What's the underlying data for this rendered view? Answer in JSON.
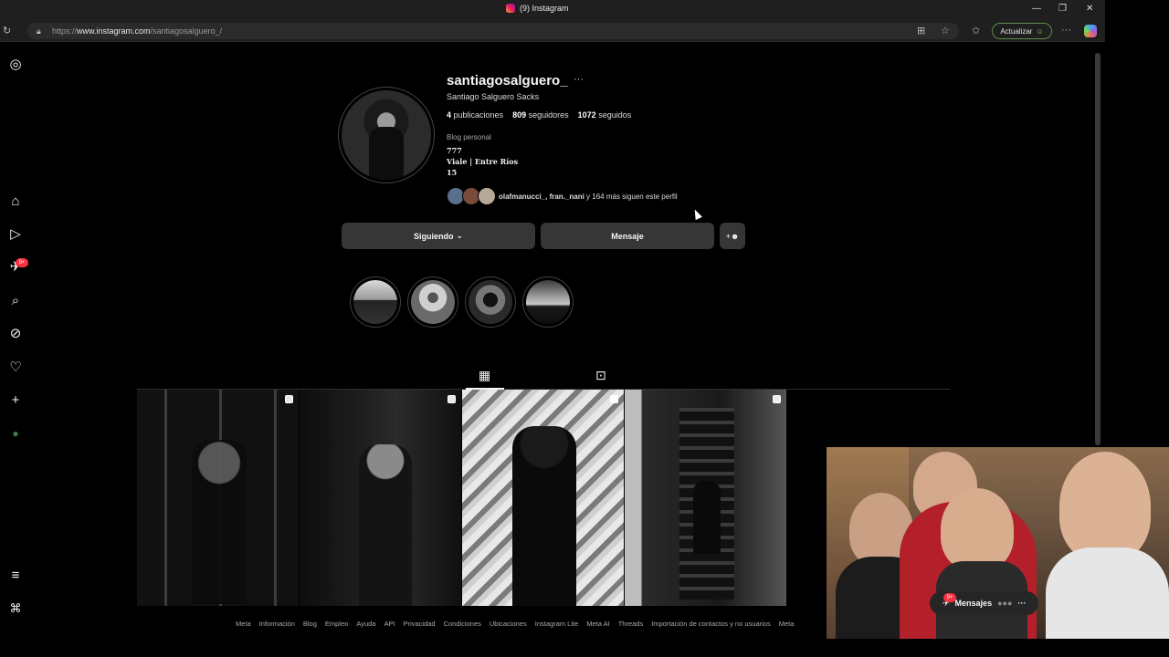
{
  "browser": {
    "tab_title": "(9) Instagram",
    "url_prefix": "https://",
    "url_domain": "www.instagram.com",
    "url_path": "/santiagosalguero_/",
    "update_label": "Actualizar",
    "window_controls": [
      "—",
      "❐",
      "✕"
    ]
  },
  "sidebar": {
    "items": [
      {
        "name": "instagram-logo",
        "glyph": "◎"
      },
      {
        "name": "home",
        "glyph": "⌂"
      },
      {
        "name": "reels",
        "glyph": "▷"
      },
      {
        "name": "messages",
        "glyph": "✈",
        "badge": "9+"
      },
      {
        "name": "search",
        "glyph": "⌕"
      },
      {
        "name": "explore",
        "glyph": "⊘"
      },
      {
        "name": "notifications",
        "glyph": "♡"
      },
      {
        "name": "create",
        "glyph": "+"
      },
      {
        "name": "profile",
        "glyph": "●"
      },
      {
        "name": "more",
        "glyph": "≡"
      },
      {
        "name": "threads",
        "glyph": "⌘"
      }
    ]
  },
  "profile": {
    "username": "santiagosalguero_",
    "more_glyph": "···",
    "full_name": "Santiago Salguero Sacks",
    "posts_count": "4",
    "posts_label": "publicaciones",
    "followers_count": "809",
    "followers_label": "seguidores",
    "following_count": "1072",
    "following_label": "seguidos",
    "category": "Blog personal",
    "bio_lines": [
      "777",
      "Viale | Entre Ríos",
      "15"
    ],
    "followed_by_names": "olafmanucci_, fran._nani",
    "followed_by_rest": " y 164 más siguen este perfil"
  },
  "actions": {
    "following_label": "Siguiendo",
    "following_chevron": "⌄",
    "message_label": "Mensaje",
    "suggest_glyph": "⁺👤"
  },
  "highlights": [
    {
      "name": "highlight-1",
      "colors": [
        "#cfcfcf",
        "#2a2a2a"
      ]
    },
    {
      "name": "highlight-2",
      "colors": [
        "#bdbdbd",
        "#3a3a3a"
      ]
    },
    {
      "name": "highlight-3",
      "colors": [
        "#8a8a8a",
        "#1a1a1a"
      ]
    },
    {
      "name": "highlight-4",
      "colors": [
        "#e0e0e0",
        "#202020"
      ]
    }
  ],
  "tabs": {
    "posts_glyph": "▦",
    "tagged_glyph": "⊡"
  },
  "posts": [
    {
      "name": "post-1",
      "bg": "#2a2a2a",
      "multi": true
    },
    {
      "name": "post-2",
      "bg": "#1c1c1c",
      "multi": true
    },
    {
      "name": "post-3",
      "bg": "#9d9d9d",
      "multi": true
    },
    {
      "name": "post-4",
      "bg": "#262626",
      "multi": true
    }
  ],
  "footer": {
    "links": [
      "Meta",
      "Información",
      "Blog",
      "Empleo",
      "Ayuda",
      "API",
      "Privacidad",
      "Condiciones",
      "Ubicaciones",
      "Instagram Lite",
      "Meta AI",
      "Threads",
      "Importación de contactos y no usuarios",
      "Meta"
    ]
  },
  "messages_pill": {
    "label": "Mensajes",
    "badge": "9+"
  }
}
